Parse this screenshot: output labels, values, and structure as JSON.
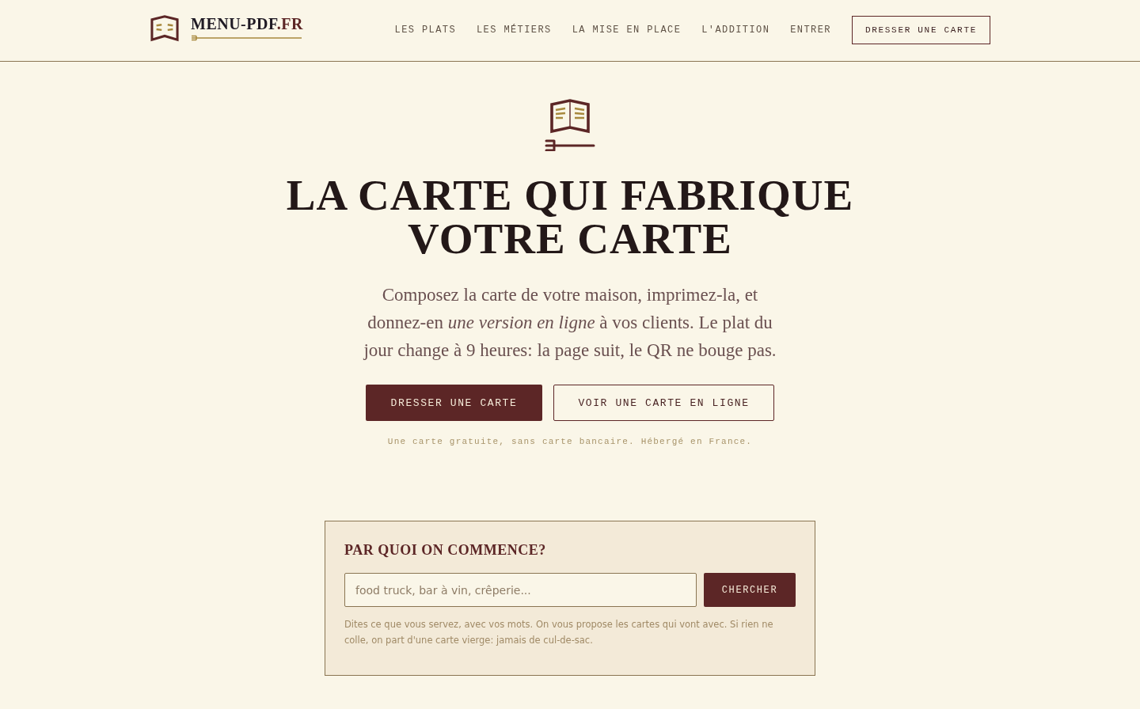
{
  "header": {
    "logo": {
      "name": "MENU-PDF",
      "suffix": ".FR"
    },
    "nav": [
      {
        "label": "LES PLATS"
      },
      {
        "label": "LES MÉTIERS"
      },
      {
        "label": "LA MISE EN PLACE"
      },
      {
        "label": "L'ADDITION"
      },
      {
        "label": "ENTRER"
      }
    ],
    "cta": "DRESSER UNE CARTE"
  },
  "hero": {
    "title": [
      "LA CARTE QUI FABRIQUE",
      "VOTRE CARTE"
    ],
    "subtitle": "Composez la carte de votre maison, imprimez-la, et donnez-en *une version en ligne* à vos clients. Le plat du jour change à 9 heures: la page suit, le QR ne bouge pas.",
    "buttons": [
      {
        "label": "DRESSER UNE CARTE",
        "kind": "primary"
      },
      {
        "label": "VOIR UNE CARTE EN LIGNE",
        "kind": "secondary"
      }
    ],
    "note": "Une carte gratuite, sans carte bancaire. Hébergé en France."
  },
  "search": {
    "title": "PAR QUOI ON COMMENCE?",
    "placeholder": "food truck, bar à vin, crêperie...",
    "button": "CHERCHER",
    "help": "Dites ce que vous servez, avec vos mots. On vous propose les cartes qui vont avec. Si rien ne colle, on part d'une carte vierge: jamais de cul-de-sac."
  }
}
